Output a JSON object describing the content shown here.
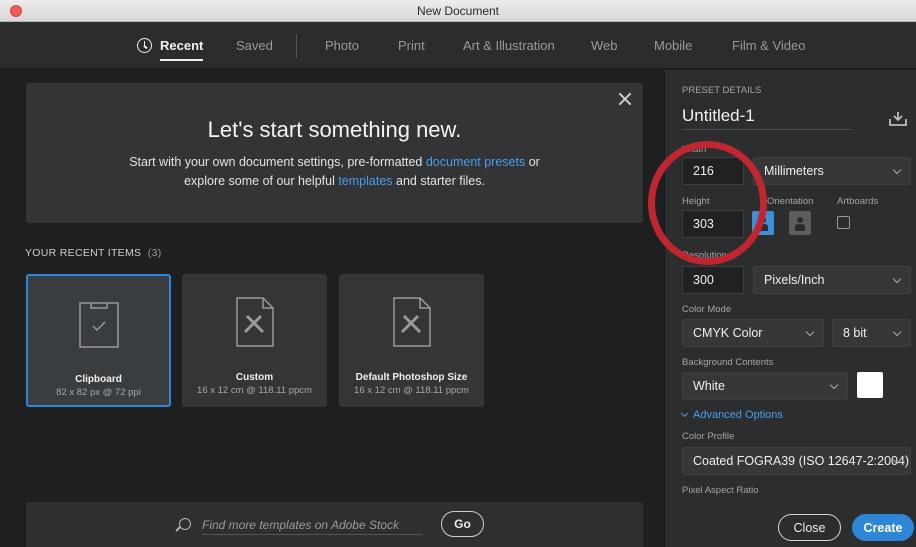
{
  "window": {
    "title": "New Document"
  },
  "nav": {
    "tabs": [
      {
        "label": "Recent",
        "active": true
      },
      {
        "label": "Saved"
      },
      {
        "label": "Photo"
      },
      {
        "label": "Print"
      },
      {
        "label": "Art & Illustration"
      },
      {
        "label": "Web"
      },
      {
        "label": "Mobile"
      },
      {
        "label": "Film & Video"
      }
    ]
  },
  "hero": {
    "title": "Let's start something new.",
    "line1_prefix": "Start with your own document settings, pre-formatted ",
    "line1_link": "document presets",
    "line1_suffix": " or",
    "line2_prefix": "explore some of our helpful ",
    "line2_link": "templates",
    "line2_suffix": " and starter files."
  },
  "recent": {
    "heading": "YOUR RECENT ITEMS",
    "count": "(3)",
    "items": [
      {
        "name": "Clipboard",
        "meta": "82 x 82 px @ 72 ppi",
        "icon": "clipboard-icon",
        "selected": true
      },
      {
        "name": "Custom",
        "meta": "16 x 12 cm @ 118.11 ppcm",
        "icon": "document-ruler-icon"
      },
      {
        "name": "Default Photoshop Size",
        "meta": "16 x 12 cm @ 118.11 ppcm",
        "icon": "document-ruler-icon"
      }
    ]
  },
  "stock": {
    "placeholder": "Find more templates on Adobe Stock",
    "go_label": "Go"
  },
  "preset": {
    "heading": "PRESET DETAILS",
    "name": "Untitled-1",
    "width_label": "Width",
    "width_value": "216",
    "unit": "Millimeters",
    "height_label": "Height",
    "height_value": "303",
    "orientation_label": "Orientation",
    "artboards_label": "Artboards",
    "resolution_label": "Resolution",
    "resolution_value": "300",
    "resolution_unit": "Pixels/Inch",
    "color_mode_label": "Color Mode",
    "color_mode": "CMYK Color",
    "bit_depth": "8 bit",
    "bg_label": "Background Contents",
    "bg_value": "White",
    "bg_swatch": "#ffffff",
    "advanced_label": "Advanced Options",
    "profile_label": "Color Profile",
    "profile_value": "Coated FOGRA39 (ISO 12647-2:2004)",
    "pixel_aspect_label": "Pixel Aspect Ratio"
  },
  "actions": {
    "close_label": "Close",
    "create_label": "Create"
  },
  "colors": {
    "accent": "#2d86d8",
    "annotation": "#c0262f"
  }
}
